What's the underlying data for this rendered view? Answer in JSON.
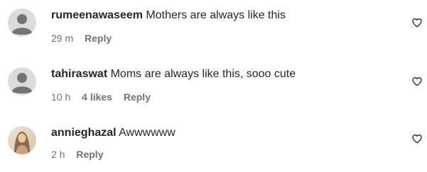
{
  "comments": [
    {
      "username": "rumeenawaseem",
      "text": "Mothers are always like this",
      "time": "29 m",
      "likes": "",
      "reply_label": "Reply",
      "avatar_icon": "default-profile-icon",
      "like_icon": "heart-outline-icon"
    },
    {
      "username": "tahiraswat",
      "text": "Moms are always like this, sooo cute",
      "time": "10 h",
      "likes": "4 likes",
      "reply_label": "Reply",
      "avatar_icon": "default-profile-icon",
      "like_icon": "heart-outline-icon"
    },
    {
      "username": "annieghazal",
      "text": "Awwwwww",
      "time": "2 h",
      "likes": "",
      "reply_label": "Reply",
      "avatar_icon": "profile-photo",
      "like_icon": "heart-outline-icon"
    }
  ],
  "colors": {
    "text_primary": "#262626",
    "text_secondary": "#737373",
    "default_avatar_bg": "#dbdbdb",
    "default_avatar_fg": "#737373"
  }
}
